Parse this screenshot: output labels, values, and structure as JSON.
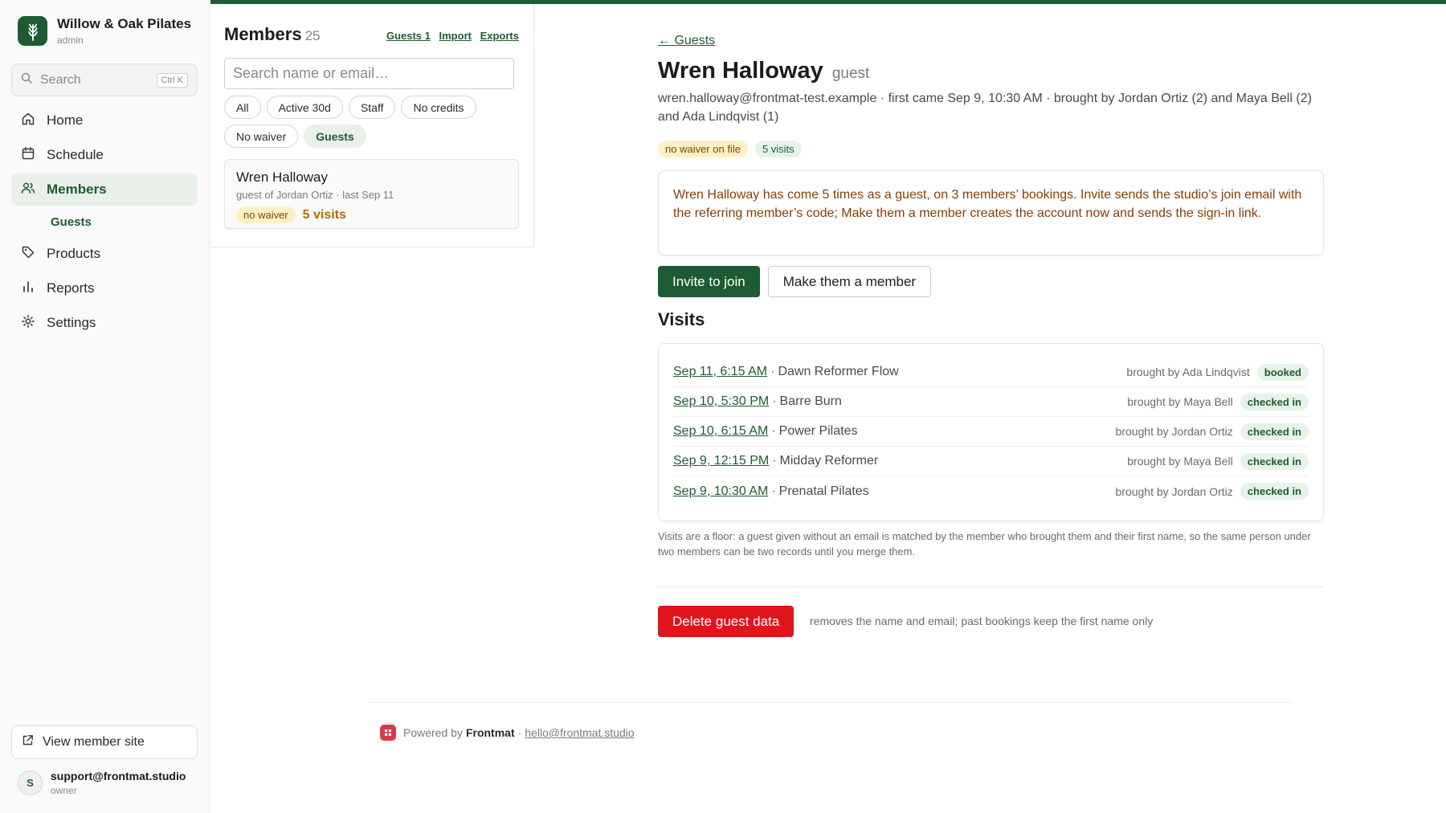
{
  "colors": {
    "accent": "#1d5c32",
    "danger": "#e0141b",
    "warning_text": "#8a3d00"
  },
  "sidebar": {
    "brand_name": "Willow & Oak Pilates",
    "brand_role": "admin",
    "search_placeholder": "Search",
    "search_shortcut": "Ctrl K",
    "nav": [
      {
        "label": "Home",
        "icon": "home-icon"
      },
      {
        "label": "Schedule",
        "icon": "calendar-icon"
      },
      {
        "label": "Members",
        "icon": "users-icon"
      },
      {
        "label": "Guests"
      },
      {
        "label": "Products",
        "icon": "tag-icon"
      },
      {
        "label": "Reports",
        "icon": "bar-chart-icon"
      },
      {
        "label": "Settings",
        "icon": "gear-icon"
      }
    ],
    "view_site": "View member site",
    "user_initial": "S",
    "user_email": "support@frontmat.studio",
    "user_role": "owner"
  },
  "list": {
    "title": "Members",
    "count": "25",
    "links": [
      "Guests 1",
      "Import",
      "Exports"
    ],
    "search_placeholder": "Search name or email…",
    "chips": [
      "All",
      "Active 30d",
      "Staff",
      "No credits",
      "No waiver",
      "Guests"
    ],
    "card": {
      "name": "Wren Halloway",
      "sub": "guest of Jordan Ortiz · last Sep 11",
      "badge": "no waiver",
      "visits": "5 visits"
    }
  },
  "detail": {
    "back": "← Guests",
    "name": "Wren Halloway",
    "tag": "guest",
    "meta": "wren.halloway@frontmat-test.example · first came Sep 9, 10:30 AM · brought by Jordan Ortiz (2) and Maya Bell (2) and Ada Lindqvist (1)",
    "badge_waiver": "no waiver on file",
    "badge_visits": "5 visits",
    "note": "Wren Halloway has come 5 times as a guest, on 3 members’ bookings. Invite sends the studio’s join email with the referring member’s code; Make them a member creates the account now and sends the sign-in link.",
    "invite_label": "Invite to join",
    "member_label": "Make them a member",
    "visits_title": "Visits",
    "visits": [
      {
        "date": "Sep 11, 6:15 AM",
        "class": "Dawn Reformer Flow",
        "by": "brought by Ada Lindqvist",
        "status": "booked"
      },
      {
        "date": "Sep 10, 5:30 PM",
        "class": "Barre Burn",
        "by": "brought by Maya Bell",
        "status": "checked in"
      },
      {
        "date": "Sep 10, 6:15 AM",
        "class": "Power Pilates",
        "by": "brought by Jordan Ortiz",
        "status": "checked in"
      },
      {
        "date": "Sep 9, 12:15 PM",
        "class": "Midday Reformer",
        "by": "brought by Maya Bell",
        "status": "checked in"
      },
      {
        "date": "Sep 9, 10:30 AM",
        "class": "Prenatal Pilates",
        "by": "brought by Jordan Ortiz",
        "status": "checked in"
      }
    ],
    "footnote": "Visits are a floor: a guest given without an email is matched by the member who brought them and their first name, so the same person under two members can be two records until you merge them.",
    "delete_label": "Delete guest data",
    "delete_note": "removes the name and email; past bookings keep the first name only"
  },
  "footer": {
    "powered": "Powered by",
    "brand": "Frontmat",
    "separator": "·",
    "email": "hello@frontmat.studio"
  }
}
